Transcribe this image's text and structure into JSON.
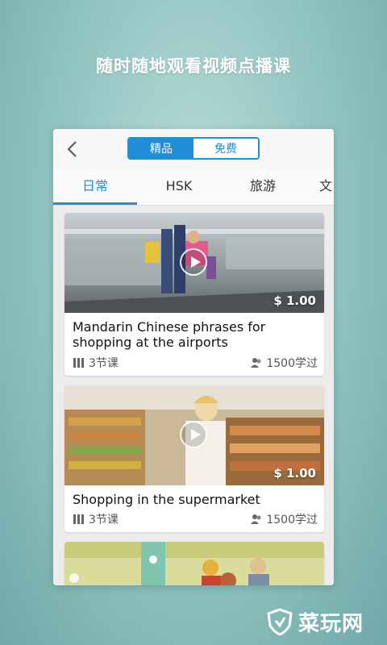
{
  "headline": "随时随地观看视频点播课",
  "segmented": {
    "left": "精品",
    "right": "免费"
  },
  "tabs": [
    "日常",
    "HSK",
    "旅游",
    "文"
  ],
  "cards": [
    {
      "title": "Mandarin Chinese phrases for shopping at the airports",
      "price": "$ 1.00",
      "lessons": "3节课",
      "learners": "1500学过"
    },
    {
      "title": "Shopping in the supermarket",
      "price": "$ 1.00",
      "lessons": "3节课",
      "learners": "1500学过"
    }
  ],
  "watermark": "菜玩网",
  "colors": {
    "accent": "#1e8ed6",
    "background": "#8fc2bf"
  }
}
